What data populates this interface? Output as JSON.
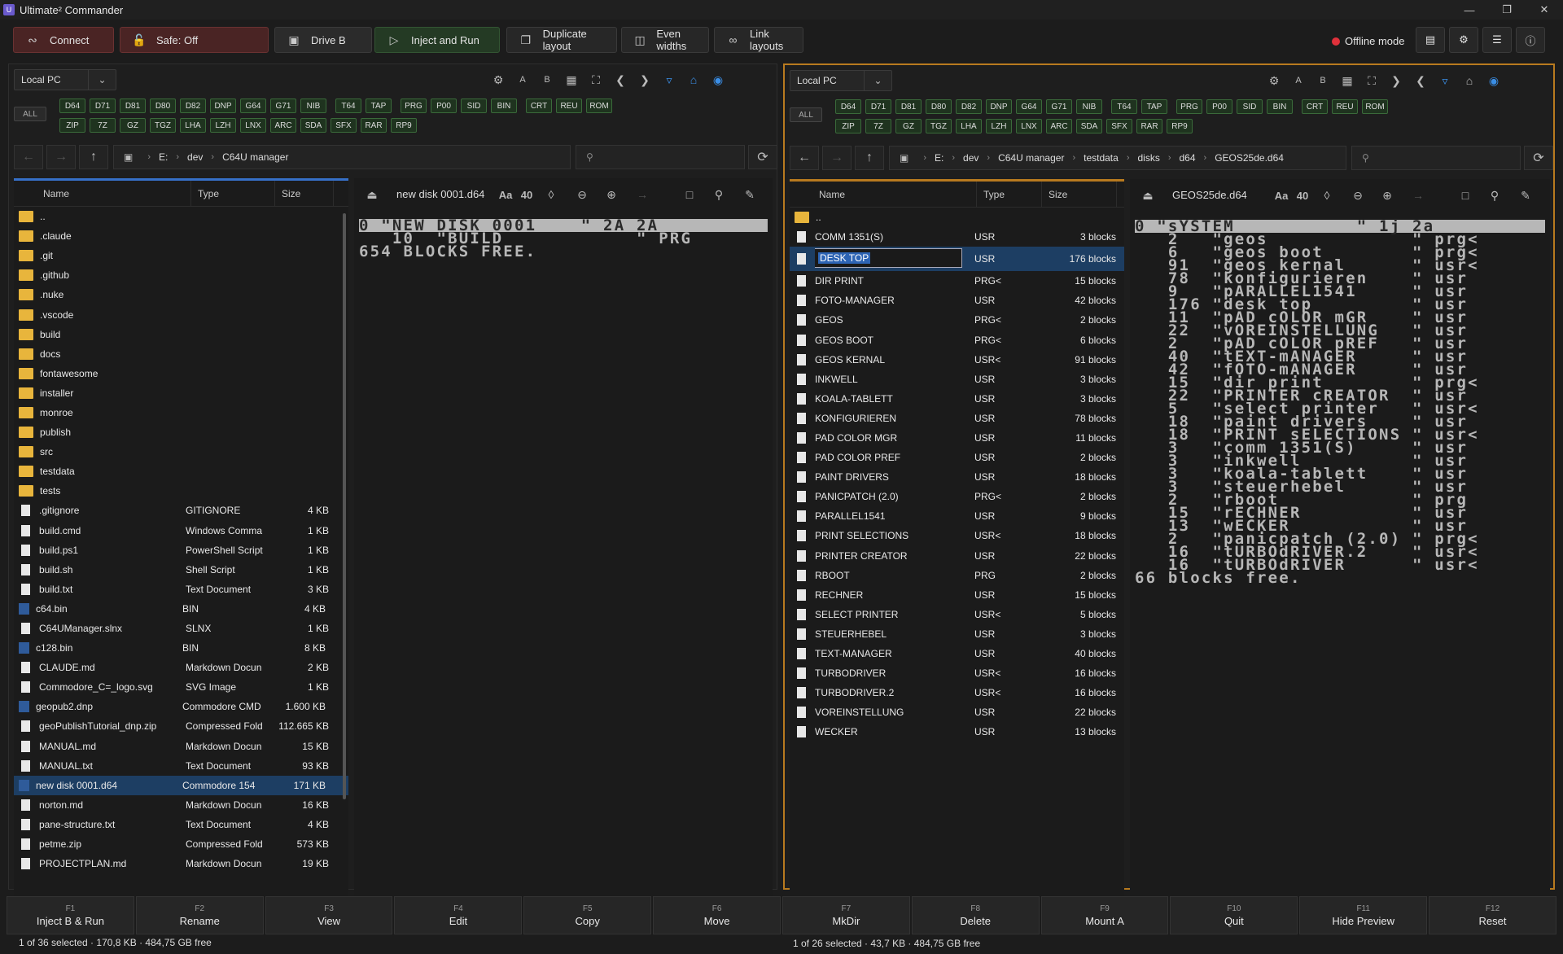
{
  "app": {
    "icon": "U",
    "title": "Ultimate² Commander"
  },
  "toolbar": {
    "connect": "Connect",
    "safe": "Safe: Off",
    "drive": "Drive B",
    "inject": "Inject and Run",
    "duplicate": "Duplicate layout",
    "even": "Even widths",
    "link": "Link layouts",
    "offline": "Offline mode"
  },
  "formats_row1": [
    "D64",
    "D71",
    "D81",
    "D80",
    "D82",
    "DNP",
    "G64",
    "G71",
    "NIB",
    "T64",
    "TAP",
    "PRG",
    "P00",
    "SID",
    "BIN",
    "CRT",
    "REU",
    "ROM"
  ],
  "formats_row2": [
    "ZIP",
    "7Z",
    "GZ",
    "TGZ",
    "LHA",
    "LZH",
    "LNX",
    "ARC",
    "SDA",
    "SFX",
    "RAR",
    "RP9"
  ],
  "all_label": "ALL",
  "left": {
    "location": "Local PC",
    "path": [
      "E:",
      "dev",
      "C64U manager"
    ],
    "cols": {
      "name": "Name",
      "type": "Type",
      "size": "Size"
    },
    "files": [
      {
        "n": "..",
        "t": "",
        "s": "",
        "k": "folder"
      },
      {
        "n": ".claude",
        "t": "",
        "s": "",
        "k": "folder"
      },
      {
        "n": ".git",
        "t": "",
        "s": "",
        "k": "folder"
      },
      {
        "n": ".github",
        "t": "",
        "s": "",
        "k": "folder"
      },
      {
        "n": ".nuke",
        "t": "",
        "s": "",
        "k": "folder"
      },
      {
        "n": ".vscode",
        "t": "",
        "s": "",
        "k": "folder"
      },
      {
        "n": "build",
        "t": "",
        "s": "",
        "k": "folder"
      },
      {
        "n": "docs",
        "t": "",
        "s": "",
        "k": "folder"
      },
      {
        "n": "fontawesome",
        "t": "",
        "s": "",
        "k": "folder"
      },
      {
        "n": "installer",
        "t": "",
        "s": "",
        "k": "folder"
      },
      {
        "n": "monroe",
        "t": "",
        "s": "",
        "k": "folder"
      },
      {
        "n": "publish",
        "t": "",
        "s": "",
        "k": "folder"
      },
      {
        "n": "src",
        "t": "",
        "s": "",
        "k": "folder"
      },
      {
        "n": "testdata",
        "t": "",
        "s": "",
        "k": "folder"
      },
      {
        "n": "tests",
        "t": "",
        "s": "",
        "k": "folder"
      },
      {
        "n": ".gitignore",
        "t": "GITIGNORE",
        "s": "4 KB",
        "k": "file"
      },
      {
        "n": "build.cmd",
        "t": "Windows Comma",
        "s": "1 KB",
        "k": "file"
      },
      {
        "n": "build.ps1",
        "t": "PowerShell Script",
        "s": "1 KB",
        "k": "file"
      },
      {
        "n": "build.sh",
        "t": "Shell Script",
        "s": "1 KB",
        "k": "file"
      },
      {
        "n": "build.txt",
        "t": "Text Document",
        "s": "3 KB",
        "k": "file"
      },
      {
        "n": "c64.bin",
        "t": "BIN",
        "s": "4 KB",
        "k": "file"
      },
      {
        "n": "C64UManager.slnx",
        "t": "SLNX",
        "s": "1 KB",
        "k": "file"
      },
      {
        "n": "c128.bin",
        "t": "BIN",
        "s": "8 KB",
        "k": "file"
      },
      {
        "n": "CLAUDE.md",
        "t": "Markdown Docun",
        "s": "2 KB",
        "k": "file"
      },
      {
        "n": "Commodore_C=_logo.svg",
        "t": "SVG Image",
        "s": "1 KB",
        "k": "file"
      },
      {
        "n": "geopub2.dnp",
        "t": "Commodore CMD",
        "s": "1.600 KB",
        "k": "file"
      },
      {
        "n": "geoPublishTutorial_dnp.zip",
        "t": "Compressed Fold",
        "s": "112.665 KB",
        "k": "file"
      },
      {
        "n": "MANUAL.md",
        "t": "Markdown Docun",
        "s": "15 KB",
        "k": "file"
      },
      {
        "n": "MANUAL.txt",
        "t": "Text Document",
        "s": "93 KB",
        "k": "file"
      },
      {
        "n": "new disk 0001.d64",
        "t": "Commodore 154",
        "s": "171 KB",
        "k": "file",
        "sel": true
      },
      {
        "n": "norton.md",
        "t": "Markdown Docun",
        "s": "16 KB",
        "k": "file"
      },
      {
        "n": "pane-structure.txt",
        "t": "Text Document",
        "s": "4 KB",
        "k": "file"
      },
      {
        "n": "petme.zip",
        "t": "Compressed Fold",
        "s": "573 KB",
        "k": "file"
      },
      {
        "n": "PROJECTPLAN.md",
        "t": "Markdown Docun",
        "s": "19 KB",
        "k": "file"
      }
    ],
    "preview_title": "new disk 0001.d64",
    "preview_font": "Aa",
    "preview_cols": "40",
    "listing": [
      {
        "inv": "0 \"NEW DISK 0001    \" 2A 2A",
        "rest": ""
      },
      {
        "inv": "",
        "rest": "   10  \"BUILD            \" PRG"
      },
      {
        "inv": "",
        "rest": "654 BLOCKS FREE."
      }
    ],
    "status": "1 of 36 selected · 170,8 KB · 484,75 GB free"
  },
  "right": {
    "location": "Local PC",
    "path": [
      "E:",
      "dev",
      "C64U manager",
      "testdata",
      "disks",
      "d64",
      "GEOS25de.d64"
    ],
    "cols": {
      "name": "Name",
      "type": "Type",
      "size": "Size"
    },
    "files": [
      {
        "n": "..",
        "t": "",
        "s": "",
        "k": "folder"
      },
      {
        "n": "COMM 1351(S)",
        "t": "USR",
        "s": "3 blocks",
        "k": "file"
      },
      {
        "n": "DESK TOP",
        "t": "USR",
        "s": "176 blocks",
        "k": "file",
        "sel": true,
        "edit": true
      },
      {
        "n": "DIR PRINT",
        "t": "PRG<",
        "s": "15 blocks",
        "k": "file"
      },
      {
        "n": "FOTO-MANAGER",
        "t": "USR",
        "s": "42 blocks",
        "k": "file"
      },
      {
        "n": "GEOS",
        "t": "PRG<",
        "s": "2 blocks",
        "k": "file"
      },
      {
        "n": "GEOS BOOT",
        "t": "PRG<",
        "s": "6 blocks",
        "k": "file"
      },
      {
        "n": "GEOS KERNAL",
        "t": "USR<",
        "s": "91 blocks",
        "k": "file"
      },
      {
        "n": "INKWELL",
        "t": "USR",
        "s": "3 blocks",
        "k": "file"
      },
      {
        "n": "KOALA-TABLETT",
        "t": "USR",
        "s": "3 blocks",
        "k": "file"
      },
      {
        "n": "KONFIGURIEREN",
        "t": "USR",
        "s": "78 blocks",
        "k": "file"
      },
      {
        "n": "PAD COLOR MGR",
        "t": "USR",
        "s": "11 blocks",
        "k": "file"
      },
      {
        "n": "PAD COLOR PREF",
        "t": "USR",
        "s": "2 blocks",
        "k": "file"
      },
      {
        "n": "PAINT DRIVERS",
        "t": "USR",
        "s": "18 blocks",
        "k": "file"
      },
      {
        "n": "PANICPATCH (2.0)",
        "t": "PRG<",
        "s": "2 blocks",
        "k": "file"
      },
      {
        "n": "PARALLEL1541",
        "t": "USR",
        "s": "9 blocks",
        "k": "file"
      },
      {
        "n": "PRINT SELECTIONS",
        "t": "USR<",
        "s": "18 blocks",
        "k": "file"
      },
      {
        "n": "PRINTER CREATOR",
        "t": "USR",
        "s": "22 blocks",
        "k": "file"
      },
      {
        "n": "RBOOT",
        "t": "PRG",
        "s": "2 blocks",
        "k": "file"
      },
      {
        "n": "RECHNER",
        "t": "USR",
        "s": "15 blocks",
        "k": "file"
      },
      {
        "n": "SELECT PRINTER",
        "t": "USR<",
        "s": "5 blocks",
        "k": "file"
      },
      {
        "n": "STEUERHEBEL",
        "t": "USR",
        "s": "3 blocks",
        "k": "file"
      },
      {
        "n": "TEXT-MANAGER",
        "t": "USR",
        "s": "40 blocks",
        "k": "file"
      },
      {
        "n": "TURBODRIVER",
        "t": "USR<",
        "s": "16 blocks",
        "k": "file"
      },
      {
        "n": "TURBODRIVER.2",
        "t": "USR<",
        "s": "16 blocks",
        "k": "file"
      },
      {
        "n": "VOREINSTELLUNG",
        "t": "USR",
        "s": "22 blocks",
        "k": "file"
      },
      {
        "n": "WECKER",
        "t": "USR",
        "s": "13 blocks",
        "k": "file"
      }
    ],
    "preview_title": "GEOS25de.d64",
    "preview_font": "Aa",
    "preview_cols": "40",
    "listing": [
      {
        "inv": "0 \"sYSTEM           \" 1j 2a",
        "rest": ""
      },
      {
        "inv": "",
        "rest": "   2   \"geos             \" prg<"
      },
      {
        "inv": "",
        "rest": "   6   \"geos boot        \" prg<"
      },
      {
        "inv": "",
        "rest": "   91  \"geos kernal      \" usr<"
      },
      {
        "inv": "",
        "rest": "   78  \"konfigurieren    \" usr"
      },
      {
        "inv": "",
        "rest": "   9   \"pARALLEL1541     \" usr"
      },
      {
        "inv": "",
        "rest": "   176 \"desk top         \" usr"
      },
      {
        "inv": "",
        "rest": "   11  \"pAD cOLOR mGR    \" usr"
      },
      {
        "inv": "",
        "rest": "   22  \"vOREINSTELLUNG   \" usr"
      },
      {
        "inv": "",
        "rest": "   2   \"pAD cOLOR pREF   \" usr"
      },
      {
        "inv": "",
        "rest": "   40  \"tEXT-mANAGER     \" usr"
      },
      {
        "inv": "",
        "rest": "   42  \"fOTO-mANAGER     \" usr"
      },
      {
        "inv": "",
        "rest": "   15  \"dir print        \" prg<"
      },
      {
        "inv": "",
        "rest": "   22  \"PRINTER cREATOR  \" usr"
      },
      {
        "inv": "",
        "rest": "   5   \"select printer   \" usr<"
      },
      {
        "inv": "",
        "rest": "   18  \"paint drivers    \" usr"
      },
      {
        "inv": "",
        "rest": "   18  \"PRINT sELECTIONS \" usr<"
      },
      {
        "inv": "",
        "rest": "   3   \"comm 1351(S)     \" usr"
      },
      {
        "inv": "",
        "rest": "   3   \"inkwell          \" usr"
      },
      {
        "inv": "",
        "rest": "   3   \"koala-tablett    \" usr"
      },
      {
        "inv": "",
        "rest": "   3   \"steuerhebel      \" usr"
      },
      {
        "inv": "",
        "rest": "   2   \"rboot            \" prg"
      },
      {
        "inv": "",
        "rest": "   15  \"rECHNER          \" usr"
      },
      {
        "inv": "",
        "rest": "   13  \"wECKER           \" usr"
      },
      {
        "inv": "",
        "rest": "   2   \"panicpatch (2.0) \" prg<"
      },
      {
        "inv": "",
        "rest": "   16  \"tURBOdRIVER.2    \" usr<"
      },
      {
        "inv": "",
        "rest": "   16  \"tURBOdRIVER      \" usr<"
      },
      {
        "inv": "",
        "rest": "66 blocks free."
      }
    ],
    "status": "1 of 26 selected · 43,7 KB · 484,75 GB free"
  },
  "fkeys": [
    {
      "k": "F1",
      "l": "Inject B & Run"
    },
    {
      "k": "F2",
      "l": "Rename"
    },
    {
      "k": "F3",
      "l": "View"
    },
    {
      "k": "F4",
      "l": "Edit"
    },
    {
      "k": "F5",
      "l": "Copy"
    },
    {
      "k": "F6",
      "l": "Move"
    },
    {
      "k": "F7",
      "l": "MkDir"
    },
    {
      "k": "F8",
      "l": "Delete"
    },
    {
      "k": "F9",
      "l": "Mount A"
    },
    {
      "k": "F10",
      "l": "Quit"
    },
    {
      "k": "F11",
      "l": "Hide Preview"
    },
    {
      "k": "F12",
      "l": "Reset"
    }
  ],
  "colors": {
    "accent": "#b87a1f",
    "selection": "#1d3e63",
    "danger": "#e0313b"
  }
}
